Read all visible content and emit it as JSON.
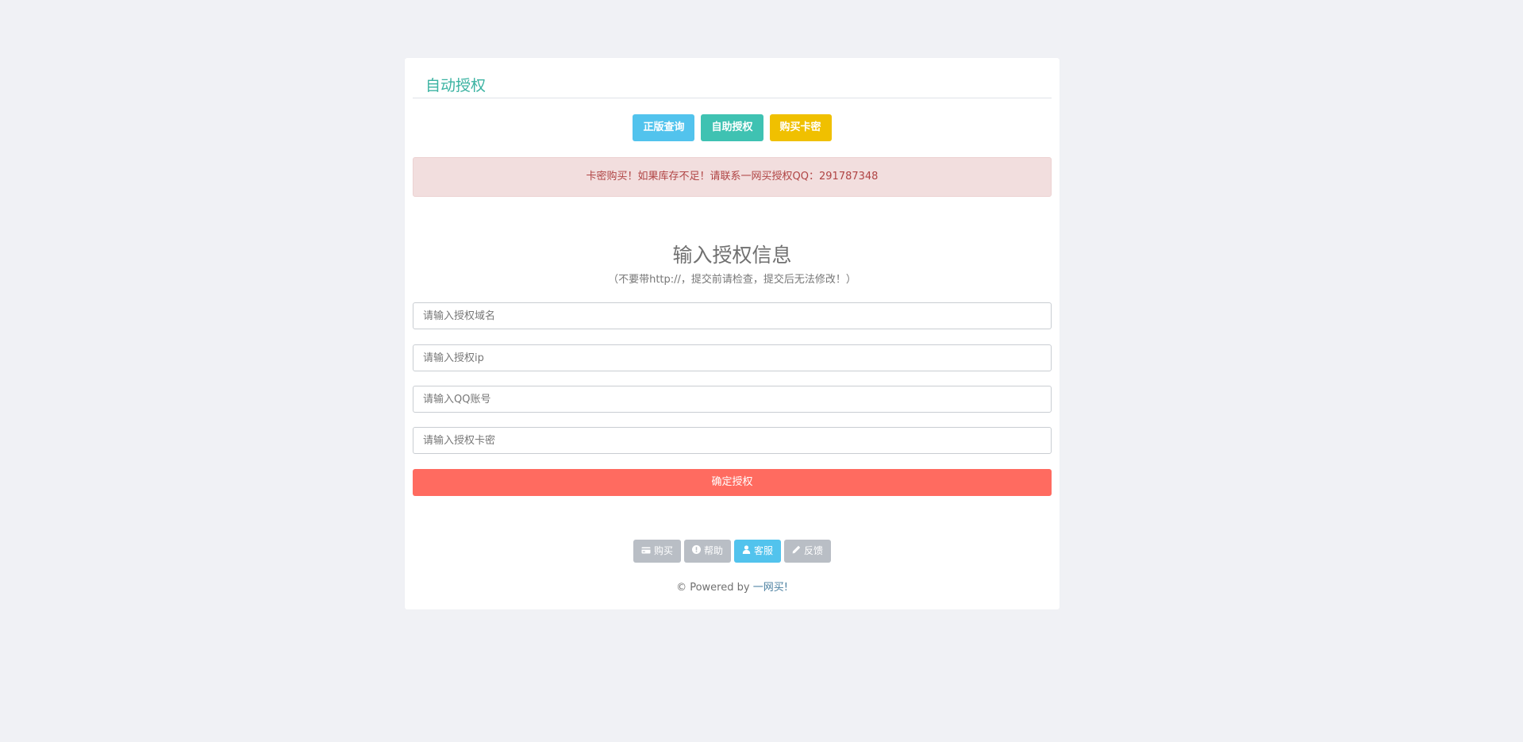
{
  "card": {
    "title": "自动授权"
  },
  "top_buttons": [
    {
      "label": "正版查询",
      "color": "#52c3ed"
    },
    {
      "label": "自助授权",
      "color": "#3fc2b2"
    },
    {
      "label": "购买卡密",
      "color": "#f0c000"
    }
  ],
  "alert": {
    "text": "卡密购买！如果库存不足！请联系一网买授权QQ：291787348"
  },
  "form": {
    "title": "输入授权信息",
    "subtitle": "（不要带http://，提交前请检查，提交后无法修改！）",
    "fields": [
      {
        "placeholder": "请输入授权域名"
      },
      {
        "placeholder": "请输入授权ip"
      },
      {
        "placeholder": "请输入QQ账号"
      },
      {
        "placeholder": "请输入授权卡密"
      }
    ],
    "submit_label": "确定授权"
  },
  "footer": {
    "buttons": [
      {
        "label": "购买",
        "icon": "credit-card-icon"
      },
      {
        "label": "帮助",
        "icon": "exclamation-circle-icon"
      },
      {
        "label": "客服",
        "icon": "user-icon"
      },
      {
        "label": "反馈",
        "icon": "pencil-icon"
      }
    ],
    "powered_prefix": "© Powered by ",
    "powered_brand": "一网买!"
  },
  "colors": {
    "background": "#f0f1f5",
    "accent_title": "#3bb3a2",
    "submit": "#ff6b60",
    "alert_bg": "#f2dede",
    "alert_text": "#b04444"
  }
}
